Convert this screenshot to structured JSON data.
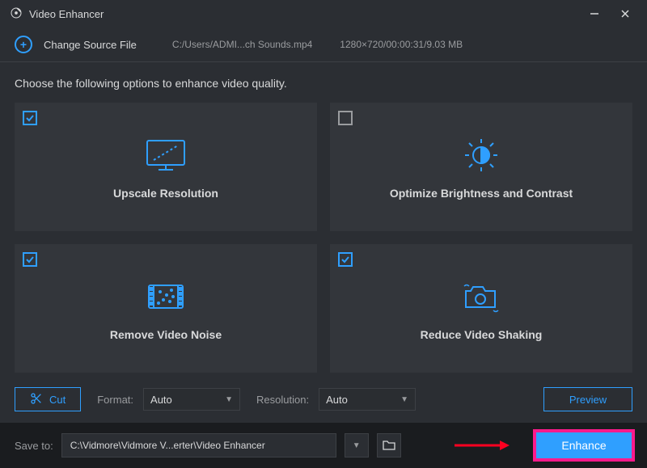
{
  "window": {
    "title": "Video Enhancer"
  },
  "source": {
    "change_label": "Change Source File",
    "path": "C:/Users/ADMI...ch Sounds.mp4",
    "meta": "1280×720/00:00:31/9.03 MB"
  },
  "instruction": "Choose the following options to enhance video quality.",
  "options": {
    "upscale": {
      "label": "Upscale Resolution",
      "checked": true
    },
    "brightness": {
      "label": "Optimize Brightness and Contrast",
      "checked": false
    },
    "noise": {
      "label": "Remove Video Noise",
      "checked": true
    },
    "shaking": {
      "label": "Reduce Video Shaking",
      "checked": true
    }
  },
  "controls": {
    "cut_label": "Cut",
    "format_label": "Format:",
    "format_value": "Auto",
    "resolution_label": "Resolution:",
    "resolution_value": "Auto",
    "preview_label": "Preview"
  },
  "footer": {
    "save_label": "Save to:",
    "save_path": "C:\\Vidmore\\Vidmore V...erter\\Video Enhancer",
    "enhance_label": "Enhance"
  }
}
